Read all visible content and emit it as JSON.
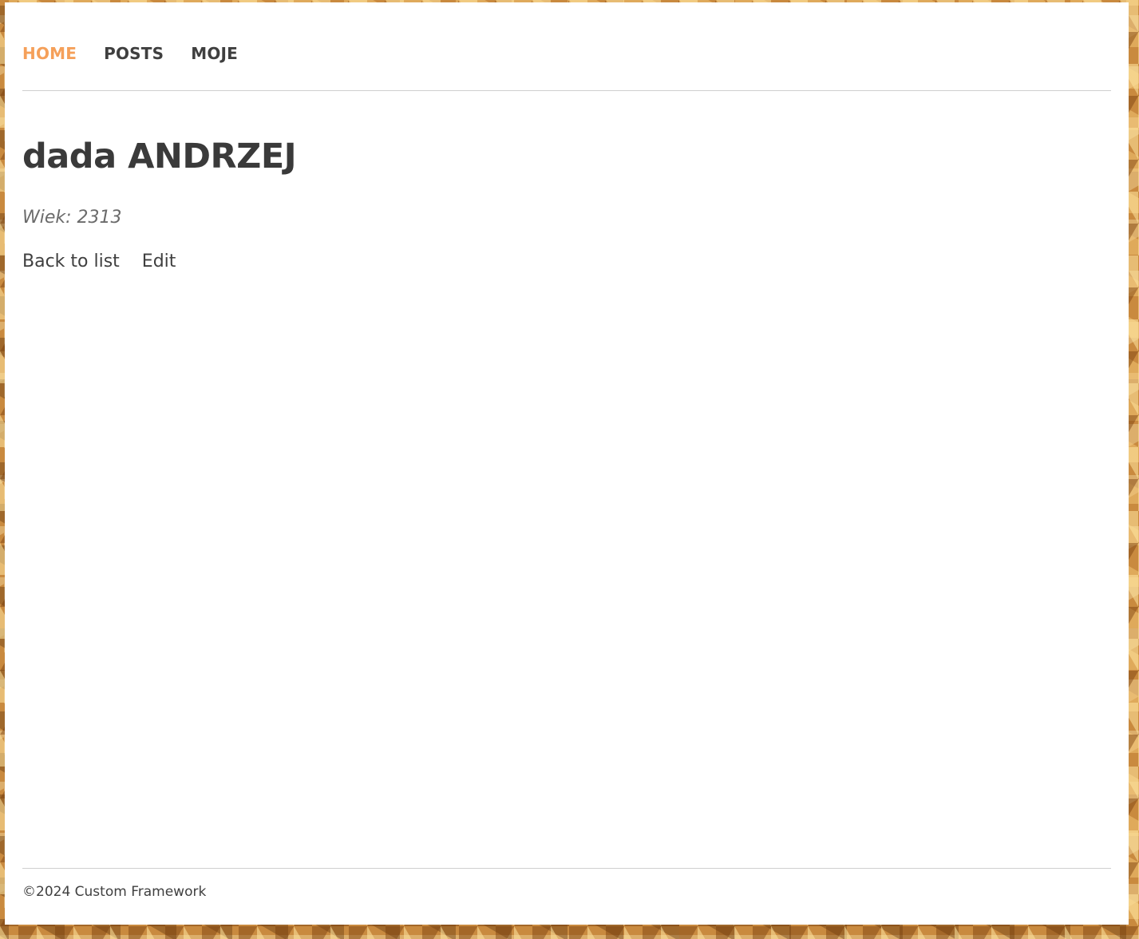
{
  "nav": {
    "items": [
      {
        "label": "HOME",
        "active": true
      },
      {
        "label": "POSTS",
        "active": false
      },
      {
        "label": "MOJE",
        "active": false
      }
    ],
    "accent_color": "#f5a05a"
  },
  "main": {
    "title": "dada ANDRZEJ",
    "age_label": "Wiek",
    "age_value": "2313",
    "actions": {
      "back_label": "Back to list",
      "edit_label": "Edit"
    }
  },
  "footer": {
    "text": "©2024 Custom Framework"
  }
}
